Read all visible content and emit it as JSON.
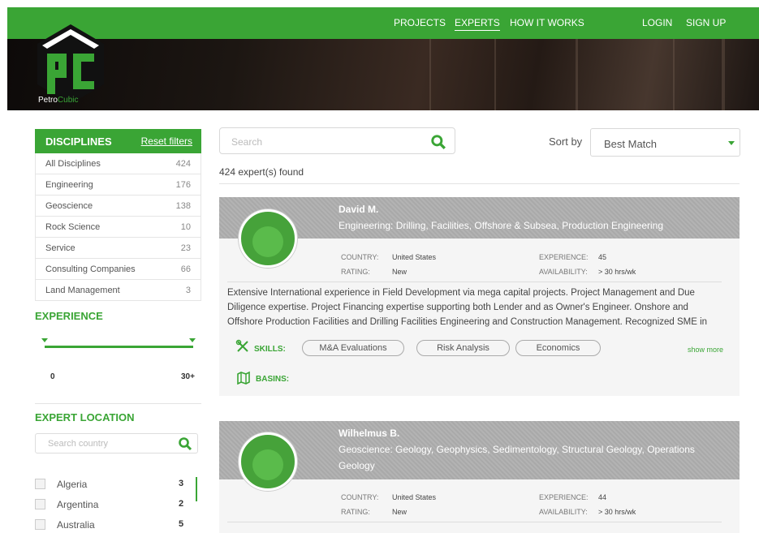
{
  "nav": {
    "projects": "PROJECTS",
    "experts": "EXPERTS",
    "how_it_works": "HOW IT WORKS",
    "login": "LOGIN",
    "signup": "SIGN UP"
  },
  "brand": {
    "prefix": "Petro",
    "suffix": "Cubic"
  },
  "disciplines": {
    "title": "DISCIPLINES",
    "reset": "Reset filters",
    "items": [
      {
        "label": "All Disciplines",
        "count": "424"
      },
      {
        "label": "Engineering",
        "count": "176"
      },
      {
        "label": "Geoscience",
        "count": "138"
      },
      {
        "label": "Rock Science",
        "count": "10"
      },
      {
        "label": "Service",
        "count": "23"
      },
      {
        "label": "Consulting Companies",
        "count": "66"
      },
      {
        "label": "Land Management",
        "count": "3"
      }
    ]
  },
  "experience": {
    "title": "EXPERIENCE",
    "min_label": "0",
    "max_label": "30+",
    "min_value": 0,
    "max_value": 30
  },
  "location": {
    "title": "EXPERT LOCATION",
    "placeholder": "Search country",
    "items": [
      {
        "label": "Algeria",
        "count": "3"
      },
      {
        "label": "Argentina",
        "count": "2"
      },
      {
        "label": "Australia",
        "count": "5"
      }
    ]
  },
  "search": {
    "placeholder": "Search"
  },
  "sort": {
    "label": "Sort by",
    "value": "Best Match"
  },
  "results_count": "424 expert(s) found",
  "experts": [
    {
      "name": "David M.",
      "disciplines": "Engineering:  Drilling, Facilities, Offshore & Subsea, Production Engineering",
      "country_label": "COUNTRY:",
      "country": "United States",
      "rating_label": "RATING:",
      "rating": "New",
      "experience_label": "EXPERIENCE:",
      "experience": "45",
      "availability_label": "AVAILABILITY:",
      "availability": "> 30 hrs/wk",
      "description": "Extensive International experience in Field Development via mega capital projects. Project Management and Due Diligence expertise. Project Financing expertise supporting both Lender and as Owner's Engineer. Onshore and Offshore Production Facilities and Drilling Facilities Engineering and Construction Management. Recognized SME in",
      "skills_label": "SKILLS:",
      "skills": [
        "M&A Evaluations",
        "Risk Analysis",
        "Economics"
      ],
      "show_more": "show more",
      "basins_label": "BASINS:"
    },
    {
      "name": "Wilhelmus B.",
      "disciplines": "Geoscience:  Geology, Geophysics, Sedimentology, Structural Geology, Operations Geology",
      "country_label": "COUNTRY:",
      "country": "United States",
      "rating_label": "RATING:",
      "rating": "New",
      "experience_label": "EXPERIENCE:",
      "experience": "44",
      "availability_label": "AVAILABILITY:",
      "availability": "> 30 hrs/wk"
    }
  ],
  "colors": {
    "accent": "#3aa535",
    "band": "#adadad"
  }
}
